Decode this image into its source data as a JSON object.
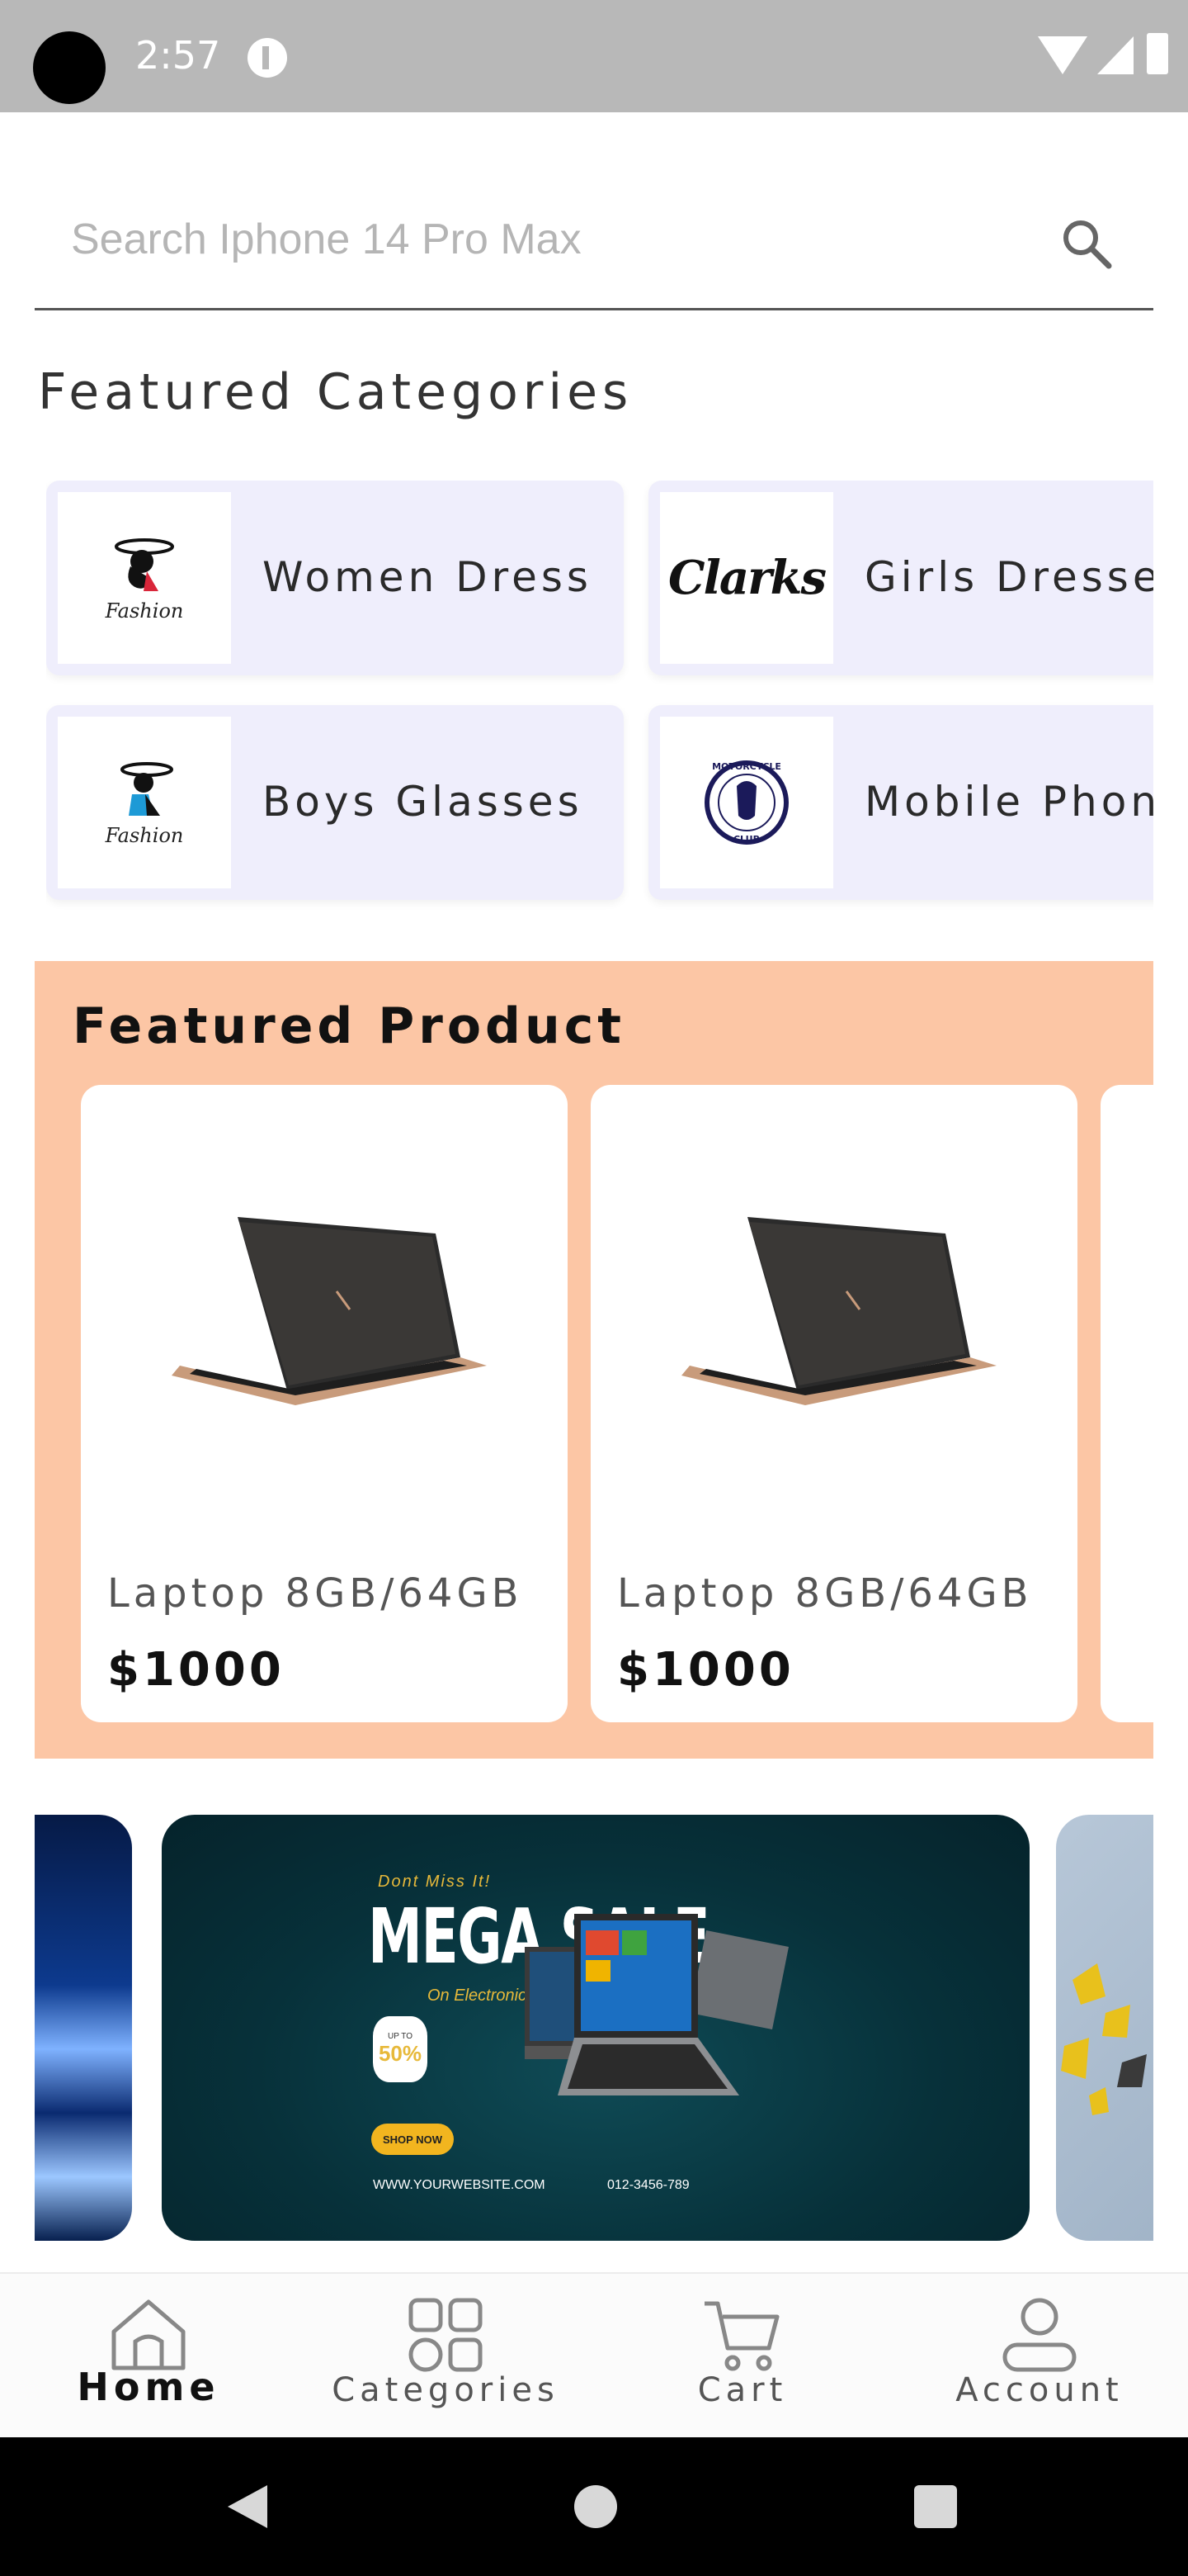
{
  "status_bar": {
    "time": "2:57"
  },
  "search": {
    "placeholder": "Search Iphone 14 Pro Max"
  },
  "featured_categories": {
    "title": "Featured Categories",
    "items": [
      {
        "label": "Women Dress",
        "logo": "fashion-logo",
        "logo_text": "Fashion"
      },
      {
        "label": "Girls Dresses",
        "logo": "clarks-logo",
        "logo_text": "Clarks"
      },
      {
        "label": "Boys Glasses",
        "logo": "fashion-logo",
        "logo_text": "Fashion"
      },
      {
        "label": "Mobile Phones",
        "logo": "motorcycle-club-logo",
        "logo_text": "MOTORCYCLE CLUB"
      }
    ]
  },
  "featured_product": {
    "title": "Featured Product",
    "background": "#fcc6a5",
    "products": [
      {
        "name": "Laptop 8GB/64GB",
        "price": "$1000",
        "image": "laptop-image"
      },
      {
        "name": "Laptop 8GB/64GB",
        "price": "$1000",
        "image": "laptop-image"
      }
    ]
  },
  "banner": {
    "dont_miss": "Dont Miss It!",
    "headline": "MEGA SALE",
    "subline": "On Electronic Products",
    "badge_up_to": "UP TO",
    "badge_pct": "50%",
    "cta": "SHOP NOW",
    "website": "WWW.YOURWEBSITE.COM",
    "phone": "012-3456-789"
  },
  "bottom_nav": {
    "items": [
      {
        "label": "Home",
        "icon": "home-icon",
        "active": true
      },
      {
        "label": "Categories",
        "icon": "categories-icon",
        "active": false
      },
      {
        "label": "Cart",
        "icon": "cart-icon",
        "active": false
      },
      {
        "label": "Account",
        "icon": "account-icon",
        "active": false
      }
    ]
  }
}
